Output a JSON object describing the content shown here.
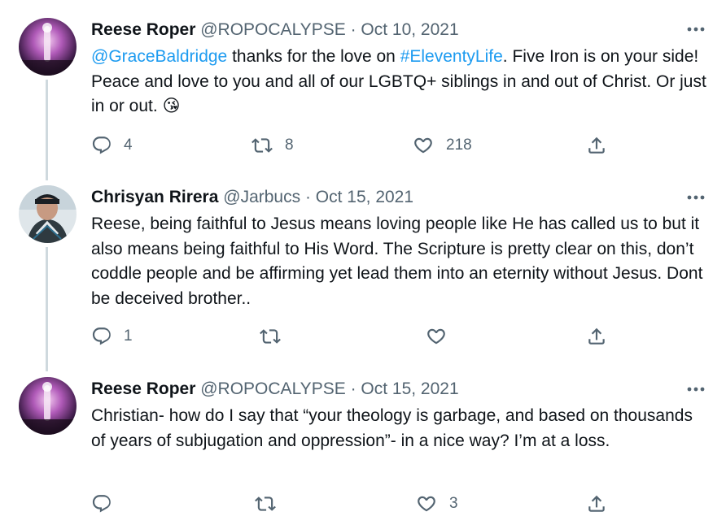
{
  "tweets": [
    {
      "author_name": "Reese Roper",
      "handle": "@ROPOCALYPSE",
      "separator": "·",
      "date": "Oct 10, 2021",
      "text_mention": "@GraceBaldridge",
      "text_part1": " thanks for the love on ",
      "text_hashtag": "#EleventyLife",
      "text_part2": ". Five Iron is on your side! Peace and love to you and all of our LGBTQ+ siblings in and out of Christ. Or just in or out. ",
      "emoji": "😘",
      "reply_count": "4",
      "retweet_count": "8",
      "like_count": "218"
    },
    {
      "author_name": "Chrisyan Rirera",
      "handle": "@Jarbucs",
      "separator": "·",
      "date": "Oct 15, 2021",
      "text": "Reese, being faithful to Jesus means loving people like He has called us to but it also means being faithful to His Word. The Scripture is pretty clear on this, don’t coddle people and be affirming yet lead them into an eternity without Jesus. Dont be deceived brother..",
      "reply_count": "1",
      "retweet_count": "",
      "like_count": ""
    },
    {
      "author_name": "Reese Roper",
      "handle": "@ROPOCALYPSE",
      "separator": "·",
      "date": "Oct 15, 2021",
      "text": "Christian- how do I say that “your theology is garbage, and based on thousands of years of subjugation and oppression”- in a nice way? I’m at a loss.",
      "reply_count": "",
      "retweet_count": "",
      "like_count": "3"
    }
  ],
  "colors": {
    "link": "#1d9bf0",
    "secondary_text": "#536471",
    "thread_line": "#cfd9de"
  },
  "icons": [
    "reply-icon",
    "retweet-icon",
    "like-icon",
    "share-icon",
    "more-icon"
  ]
}
